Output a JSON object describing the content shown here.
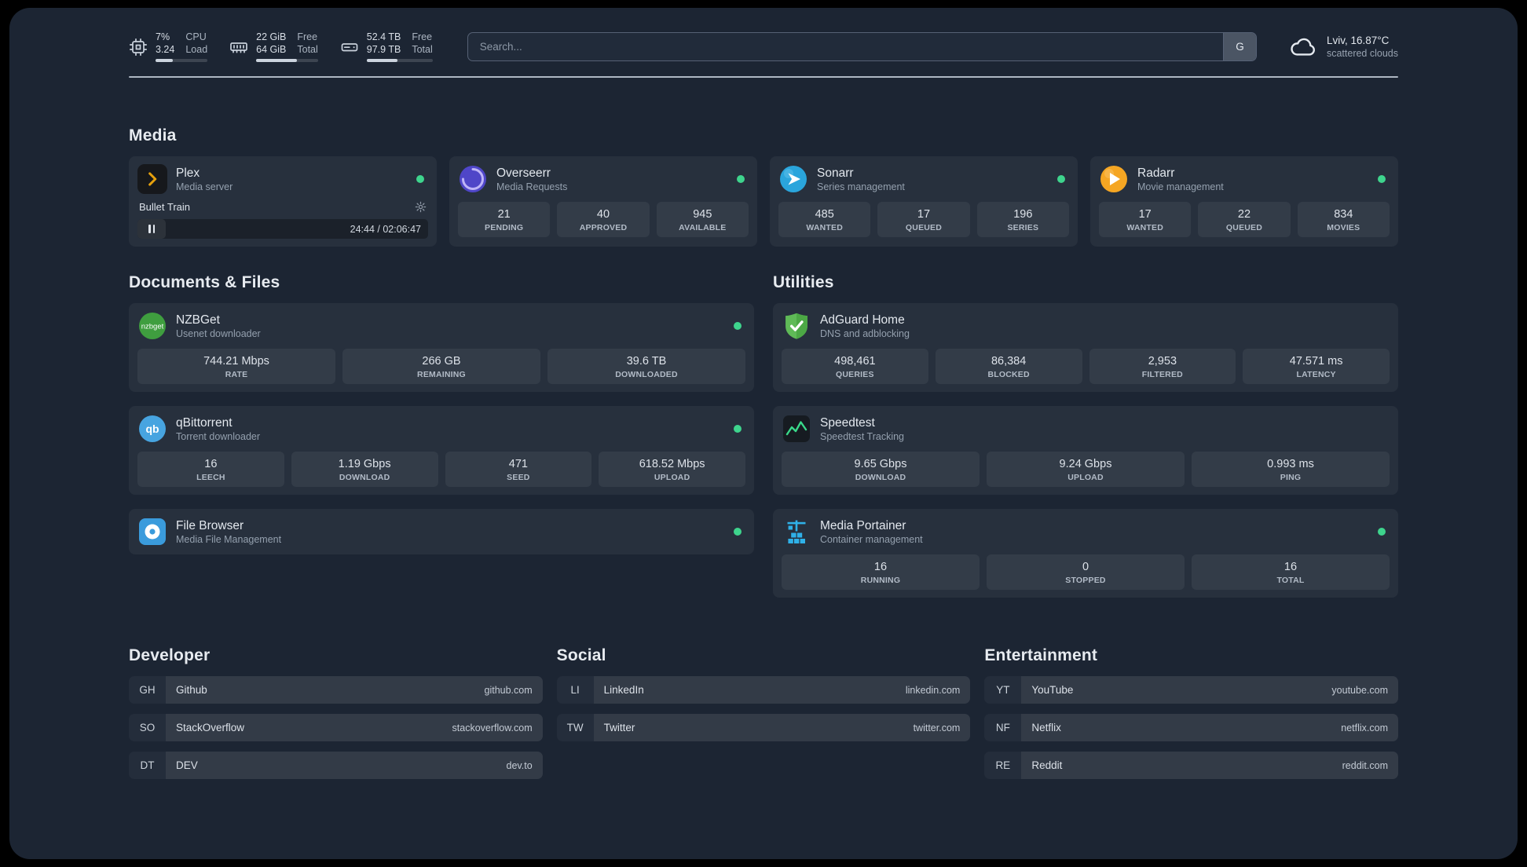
{
  "topbar": {
    "resources": [
      {
        "v1": "7%",
        "l1": "CPU",
        "v2": "3.24",
        "l2": "Load",
        "bar_style": "width:33%"
      },
      {
        "v1": "22 GiB",
        "l1": "Free",
        "v2": "64 GiB",
        "l2": "Total",
        "bar_style": "width:66%"
      },
      {
        "v1": "52.4 TB",
        "l1": "Free",
        "v2": "97.9 TB",
        "l2": "Total",
        "bar_style": "width:47%"
      }
    ],
    "search": {
      "placeholder": "Search...",
      "provider": "G"
    },
    "weather": {
      "location": "Lviv, 16.87°C",
      "condition": "scattered clouds"
    }
  },
  "media": {
    "title": "Media",
    "plex": {
      "name": "Plex",
      "desc": "Media server",
      "track": "Bullet Train",
      "time": "24:44 / 02:06:47"
    },
    "overseerr": {
      "name": "Overseerr",
      "desc": "Media Requests",
      "stats": [
        {
          "value": "21",
          "label": "PENDING"
        },
        {
          "value": "40",
          "label": "APPROVED"
        },
        {
          "value": "945",
          "label": "AVAILABLE"
        }
      ]
    },
    "sonarr": {
      "name": "Sonarr",
      "desc": "Series management",
      "stats": [
        {
          "value": "485",
          "label": "WANTED"
        },
        {
          "value": "17",
          "label": "QUEUED"
        },
        {
          "value": "196",
          "label": "SERIES"
        }
      ]
    },
    "radarr": {
      "name": "Radarr",
      "desc": "Movie management",
      "stats": [
        {
          "value": "17",
          "label": "WANTED"
        },
        {
          "value": "22",
          "label": "QUEUED"
        },
        {
          "value": "834",
          "label": "MOVIES"
        }
      ]
    }
  },
  "documents": {
    "title": "Documents & Files",
    "nzbget": {
      "name": "NZBGet",
      "desc": "Usenet downloader",
      "stats": [
        {
          "value": "744.21 Mbps",
          "label": "RATE"
        },
        {
          "value": "266 GB",
          "label": "REMAINING"
        },
        {
          "value": "39.6 TB",
          "label": "DOWNLOADED"
        }
      ]
    },
    "qbittorrent": {
      "name": "qBittorrent",
      "desc": "Torrent downloader",
      "stats": [
        {
          "value": "16",
          "label": "LEECH"
        },
        {
          "value": "1.19 Gbps",
          "label": "DOWNLOAD"
        },
        {
          "value": "471",
          "label": "SEED"
        },
        {
          "value": "618.52 Mbps",
          "label": "UPLOAD"
        }
      ]
    },
    "filebrowser": {
      "name": "File Browser",
      "desc": "Media File Management"
    }
  },
  "utilities": {
    "title": "Utilities",
    "adguard": {
      "name": "AdGuard Home",
      "desc": "DNS and adblocking",
      "stats": [
        {
          "value": "498,461",
          "label": "QUERIES"
        },
        {
          "value": "86,384",
          "label": "BLOCKED"
        },
        {
          "value": "2,953",
          "label": "FILTERED"
        },
        {
          "value": "47.571 ms",
          "label": "LATENCY"
        }
      ]
    },
    "speedtest": {
      "name": "Speedtest",
      "desc": "Speedtest Tracking",
      "stats": [
        {
          "value": "9.65 Gbps",
          "label": "DOWNLOAD"
        },
        {
          "value": "9.24 Gbps",
          "label": "UPLOAD"
        },
        {
          "value": "0.993 ms",
          "label": "PING"
        }
      ]
    },
    "portainer": {
      "name": "Media Portainer",
      "desc": "Container management",
      "stats": [
        {
          "value": "16",
          "label": "RUNNING"
        },
        {
          "value": "0",
          "label": "STOPPED"
        },
        {
          "value": "16",
          "label": "TOTAL"
        }
      ]
    }
  },
  "bookmarks": {
    "developer": {
      "title": "Developer",
      "items": [
        {
          "abbr": "GH",
          "name": "Github",
          "url": "github.com"
        },
        {
          "abbr": "SO",
          "name": "StackOverflow",
          "url": "stackoverflow.com"
        },
        {
          "abbr": "DT",
          "name": "DEV",
          "url": "dev.to"
        }
      ]
    },
    "social": {
      "title": "Social",
      "items": [
        {
          "abbr": "LI",
          "name": "LinkedIn",
          "url": "linkedin.com"
        },
        {
          "abbr": "TW",
          "name": "Twitter",
          "url": "twitter.com"
        }
      ]
    },
    "entertainment": {
      "title": "Entertainment",
      "items": [
        {
          "abbr": "YT",
          "name": "YouTube",
          "url": "youtube.com"
        },
        {
          "abbr": "NF",
          "name": "Netflix",
          "url": "netflix.com"
        },
        {
          "abbr": "RE",
          "name": "Reddit",
          "url": "reddit.com"
        }
      ]
    }
  }
}
